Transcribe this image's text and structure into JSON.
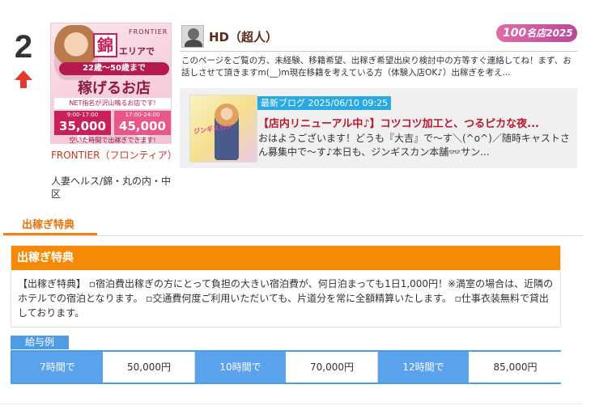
{
  "ranking": {
    "rank": "2",
    "trend": "up",
    "trend_color": "#e8382a"
  },
  "shop": {
    "banner": {
      "kanji": "錦",
      "area_text": "エリアで",
      "brand": "FRONTIER",
      "age_text": "22歳〜50歳まで",
      "slogan": "稼げるお店",
      "net_text": "NET指名が沢山鳴るお店です!",
      "pay1_time": "9:00-17:00",
      "pay1_value": "35,000円",
      "pay2_time": "17:00-24:00",
      "pay2_value": "45,000円",
      "footer": "空いた時間で出稼ぎできます!"
    },
    "name": "FRONTIER（フロンティア）",
    "category": "人妻ヘルス/錦・丸の内・中区"
  },
  "staff": {
    "name": "HD（超人）",
    "badge_num": "100",
    "badge_text": "名店2025",
    "message": "このページをご覧の方、未経験、移籍希望、出稼ぎ希望出戻り検討中の方等すぐ連絡してね！まず、お話しさせて頂きますm(__)m現在移籍を考えている方（体験入店OK♪）出稼ぎを考え..."
  },
  "blog": {
    "tag": "最新ブログ 2025/06/10 09:25",
    "thumb_text": "ジンギスカン",
    "title": "【店内リニューアル中♪】コツコツ加工と、つるピカな夜...",
    "excerpt": "おはようございます！どうも『大吉』で〜す＼(^o^)／随時キャストさん募集中で〜す♪本日も、ジンギスカン本舗👓サン..."
  },
  "tab": {
    "label": "出稼ぎ特典"
  },
  "section": {
    "title": "出稼ぎ特典",
    "body": "【出稼ぎ特典】 ▫宿泊費出稼ぎの方にとって負担の大きい宿泊費が、何日泊まっても1日1,000円！※満室の場合は、近隣のホテルでの宿泊となります。 ▫交通費何度ご利用いただいても、片道分を常に全額精算いたします。 ▫仕事衣装無料で貸出しております。"
  },
  "salary": {
    "tag": "給与例",
    "rows": [
      {
        "hours": "7時間で",
        "amount": "50,000円"
      },
      {
        "hours": "10時間で",
        "amount": "70,000円"
      },
      {
        "hours": "12時間で",
        "amount": "85,000円"
      }
    ]
  },
  "colors": {
    "accent_orange": "#f58a07",
    "link_red": "#c4381d",
    "blog_blue": "#29a9e1",
    "salary_blue": "#4f9be6"
  }
}
